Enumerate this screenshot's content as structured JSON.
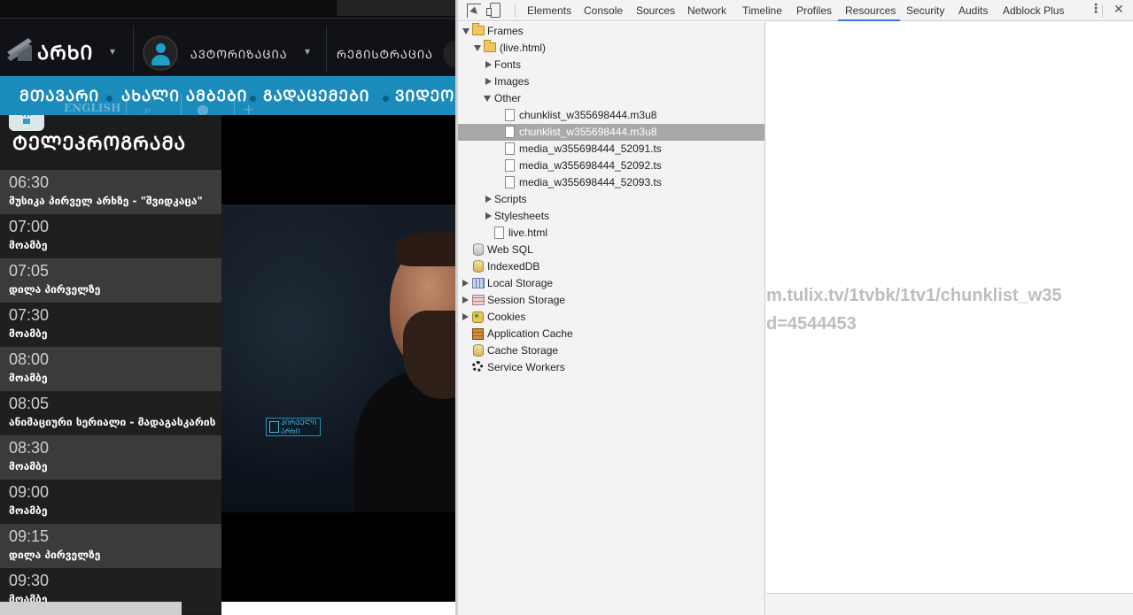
{
  "site": {
    "logo_text": "ᲐᲠᲮᲘ",
    "header_links": {
      "login": "ᲐᲕᲢᲝᲠᲘᲖᲐᲪᲘᲐ",
      "register": "ᲠᲔᲒᲘᲡᲢᲠᲐᲪᲘᲐ"
    },
    "nav": [
      "ᲛᲗᲐᲕᲐᲠᲘ",
      "ᲐᲮᲐᲚᲘ ᲐᲛᲑᲔᲑᲘ",
      "ᲒᲐᲓᲐᲪᲔᲛᲔᲑᲘ",
      "ᲕᲘᲓᲔᲝ"
    ],
    "lang": "ENGLISH",
    "program_title": "ᲢᲔᲚᲔᲞᲠᲝᲒᲠᲐᲛᲐ",
    "schedule": [
      {
        "time": "06:30",
        "show": "მუსიკა პირველ არხზე - \"შვიდკაცა\""
      },
      {
        "time": "07:00",
        "show": "მოამბე"
      },
      {
        "time": "07:05",
        "show": "დილა პირველზე"
      },
      {
        "time": "07:30",
        "show": "მოამბე"
      },
      {
        "time": "08:00",
        "show": "მოამბე"
      },
      {
        "time": "08:05",
        "show": "ანიმაციური სერიალი - მადაგასკარის"
      },
      {
        "time": "08:30",
        "show": "მოამბე"
      },
      {
        "time": "09:00",
        "show": "მოამბე"
      },
      {
        "time": "09:15",
        "show": "დილა პირველზე"
      },
      {
        "time": "09:30",
        "show": "მოამბე"
      }
    ],
    "video_logo": "ᲞᲘᲠᲕᲔᲚᲘ ᲐᲠᲮᲘ"
  },
  "devtools": {
    "tabs": [
      "Elements",
      "Console",
      "Sources",
      "Network",
      "Timeline",
      "Profiles",
      "Resources",
      "Security",
      "Audits",
      "Adblock Plus"
    ],
    "active_tab": "Resources",
    "tree": {
      "frames": "Frames",
      "frame": "(live.html)",
      "fonts": "Fonts",
      "images": "Images",
      "other": "Other",
      "other_files": [
        "chunklist_w355698444.m3u8",
        "chunklist_w355698444.m3u8",
        "media_w355698444_52091.ts",
        "media_w355698444_52092.ts",
        "media_w355698444_52093.ts"
      ],
      "selected_file_index": 1,
      "scripts": "Scripts",
      "stylesheets": "Stylesheets",
      "live_html": "live.html",
      "web_sql": "Web SQL",
      "indexeddb": "IndexedDB",
      "local_storage": "Local Storage",
      "session_storage": "Session Storage",
      "cookies": "Cookies",
      "app_cache": "Application Cache",
      "cache_storage": "Cache Storage",
      "service_workers": "Service Workers"
    },
    "content_lines": [
      "m.tulix.tv/1tvbk/1tv1/chunklist_w35",
      "d=4544453"
    ]
  },
  "colors": {
    "nav_blue": "#1b8bbb",
    "selection_gray": "#a8a8a8",
    "devtools_accent": "#3879d9"
  }
}
